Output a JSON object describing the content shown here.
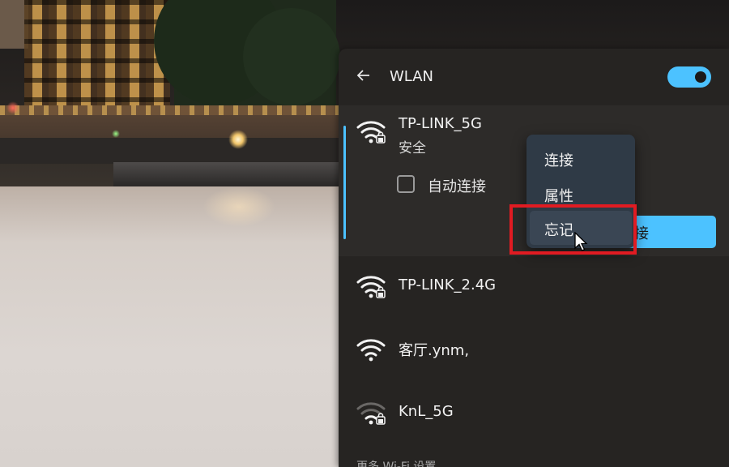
{
  "panel": {
    "title": "WLAN",
    "toggle_on": true,
    "accent_color": "#4cc2ff"
  },
  "networks": [
    {
      "name": "TP-LINK_5G",
      "status": "安全",
      "secured": true,
      "signal": "full",
      "expanded": true,
      "auto_connect_label": "自动连接",
      "auto_connect_checked": false,
      "connect_label": "接"
    },
    {
      "name": "TP-LINK_2.4G",
      "secured": true,
      "signal": "full"
    },
    {
      "name": "客厅.ynm,",
      "secured": false,
      "signal": "full"
    },
    {
      "name": "KnL_5G",
      "secured": true,
      "signal": "weak"
    }
  ],
  "footer": {
    "more_settings": "更多 Wi-Fi 设置"
  },
  "context_menu": {
    "items": [
      "连接",
      "属性",
      "忘记"
    ],
    "highlighted_index": 2,
    "highlight_color": "#e11b22"
  }
}
